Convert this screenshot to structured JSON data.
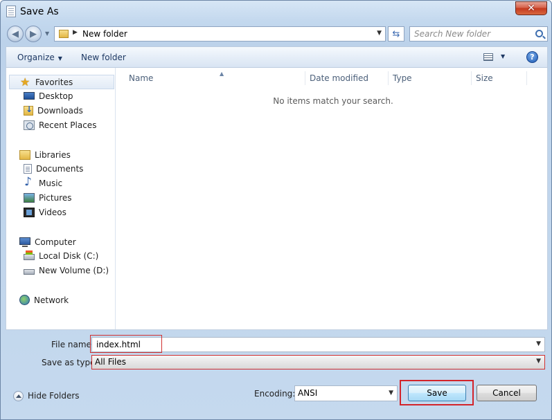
{
  "window": {
    "title": "Save As",
    "close_glyph": "✕"
  },
  "address": {
    "path": "New folder",
    "search_placeholder": "Search New folder"
  },
  "toolbar": {
    "organize": "Organize",
    "new_folder": "New folder",
    "help": "?"
  },
  "sidebar": {
    "favorites": {
      "label": "Favorites",
      "items": [
        "Desktop",
        "Downloads",
        "Recent Places"
      ]
    },
    "libraries": {
      "label": "Libraries",
      "items": [
        "Documents",
        "Music",
        "Pictures",
        "Videos"
      ]
    },
    "computer": {
      "label": "Computer",
      "items": [
        "Local Disk (C:)",
        "New Volume (D:)"
      ]
    },
    "network": {
      "label": "Network"
    }
  },
  "filelist": {
    "columns": [
      "Name",
      "Date modified",
      "Type",
      "Size"
    ],
    "empty_message": "No items match your search."
  },
  "form": {
    "file_name_label": "File name:",
    "file_name_value": "index.html",
    "save_type_label": "Save as type:",
    "save_type_value": "All Files",
    "encoding_label": "Encoding:",
    "encoding_value": "ANSI"
  },
  "footer": {
    "hide_folders": "Hide Folders",
    "save": "Save",
    "cancel": "Cancel"
  },
  "colors": {
    "highlight": "#d3232a",
    "accent": "#1e3963"
  }
}
